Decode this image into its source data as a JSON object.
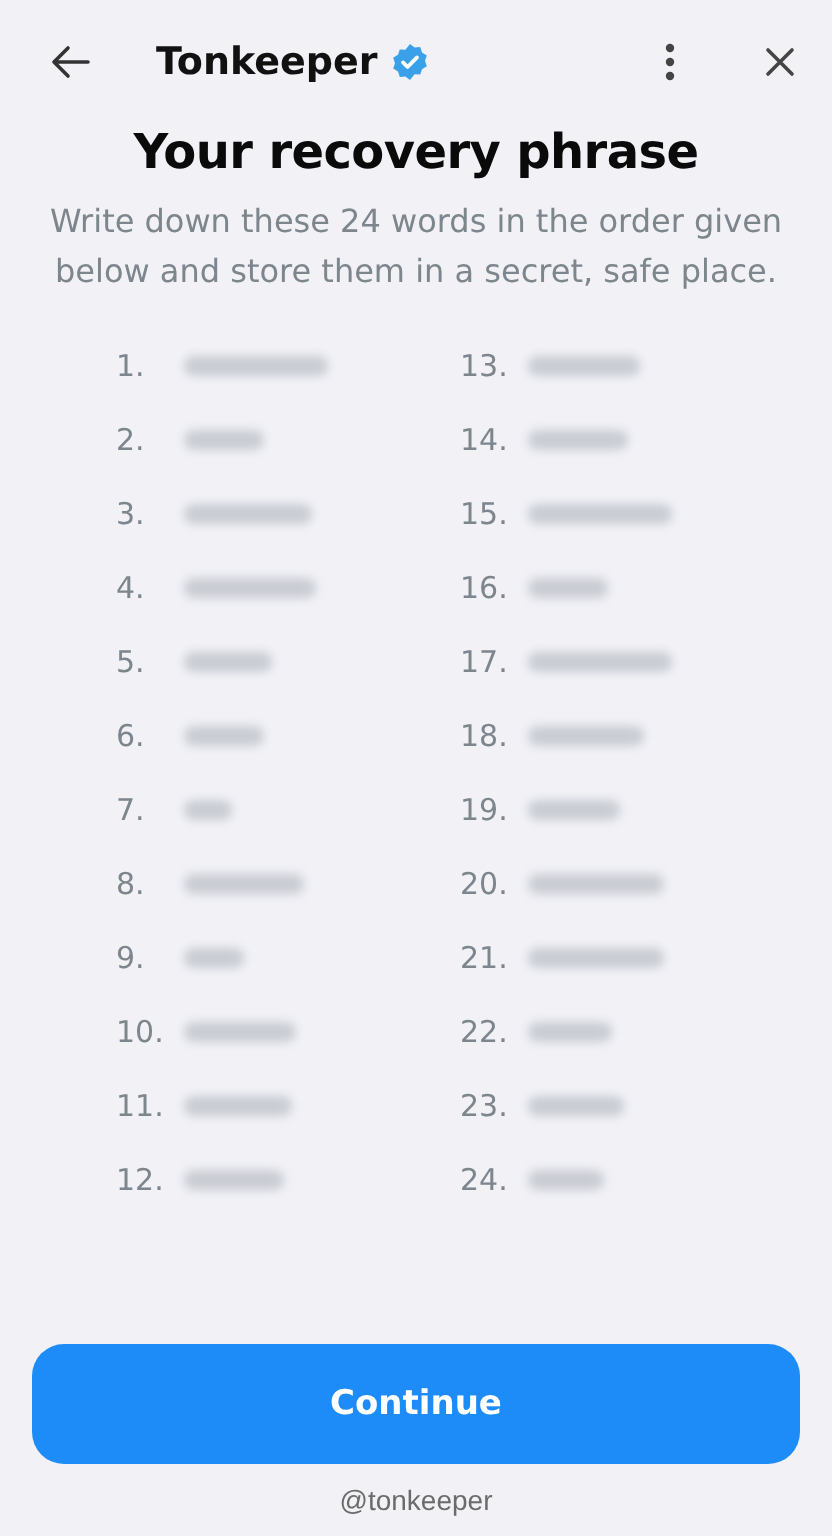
{
  "header": {
    "title": "Tonkeeper",
    "verified": true
  },
  "heading": "Your recovery phrase",
  "description": "Write down these 24 words in the order given below and store them in a secret, safe place.",
  "columns": [
    {
      "numbers": [
        "1.",
        "2.",
        "3.",
        "4.",
        "5.",
        "6.",
        "7.",
        "8.",
        "9.",
        "10.",
        "11.",
        "12."
      ]
    },
    {
      "numbers": [
        "13.",
        "14.",
        "15.",
        "16.",
        "17.",
        "18.",
        "19.",
        "20.",
        "21.",
        "22.",
        "23.",
        "24."
      ]
    }
  ],
  "button": "Continue",
  "footer": "@tonkeeper"
}
